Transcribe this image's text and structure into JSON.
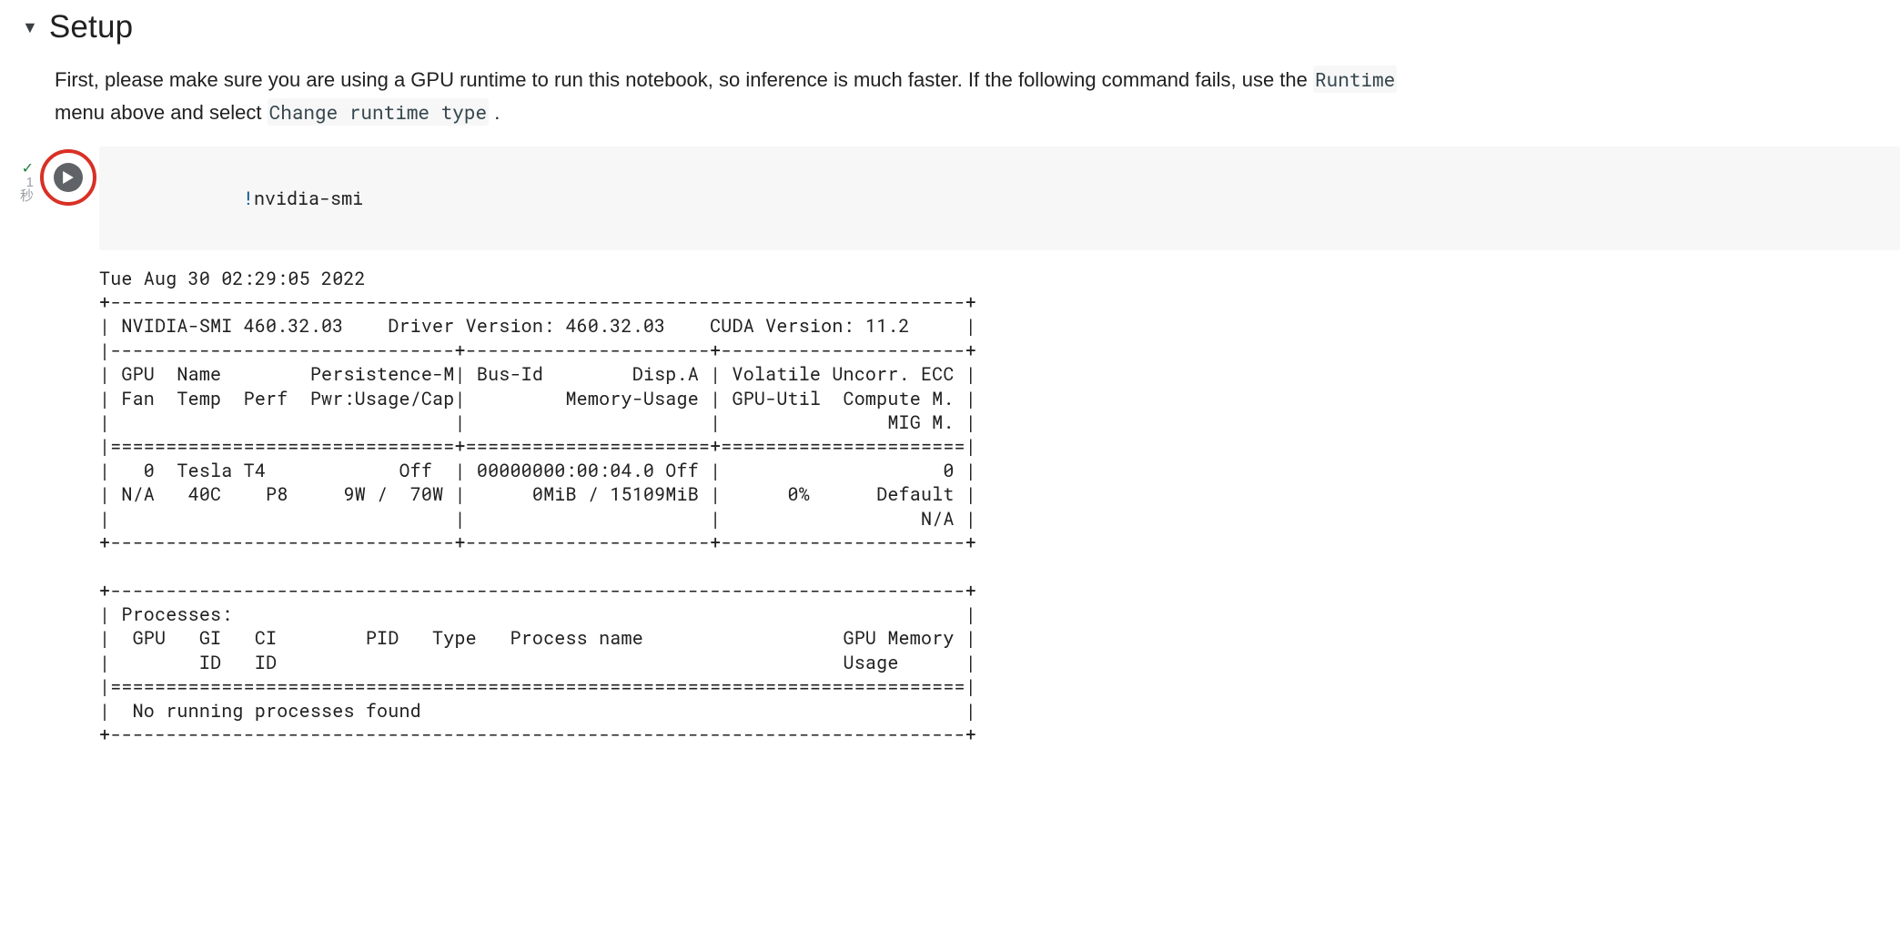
{
  "section": {
    "title": "Setup",
    "caret": "▼"
  },
  "markdown": {
    "text_before_runtime": "First, please make sure you are using a GPU runtime to run this notebook, so inference is much faster. If the following command fails, use the ",
    "code_runtime": "Runtime",
    "text_between": " menu above and select ",
    "code_changetype": "Change runtime type",
    "text_after": "."
  },
  "cell_status": {
    "check": "✓",
    "duration_number": "1",
    "duration_unit": "秒"
  },
  "code": {
    "bang": "!",
    "command": "nvidia-smi"
  },
  "output_text": "Tue Aug 30 02:29:05 2022       \n+-----------------------------------------------------------------------------+\n| NVIDIA-SMI 460.32.03    Driver Version: 460.32.03    CUDA Version: 11.2     |\n|-------------------------------+----------------------+----------------------+\n| GPU  Name        Persistence-M| Bus-Id        Disp.A | Volatile Uncorr. ECC |\n| Fan  Temp  Perf  Pwr:Usage/Cap|         Memory-Usage | GPU-Util  Compute M. |\n|                               |                      |               MIG M. |\n|===============================+======================+======================|\n|   0  Tesla T4            Off  | 00000000:00:04.0 Off |                    0 |\n| N/A   40C    P8     9W /  70W |      0MiB / 15109MiB |      0%      Default |\n|                               |                      |                  N/A |\n+-------------------------------+----------------------+----------------------+\n                                                                               \n+-----------------------------------------------------------------------------+\n| Processes:                                                                  |\n|  GPU   GI   CI        PID   Type   Process name                  GPU Memory |\n|        ID   ID                                                   Usage      |\n|=============================================================================|\n|  No running processes found                                                 |\n+-----------------------------------------------------------------------------+"
}
